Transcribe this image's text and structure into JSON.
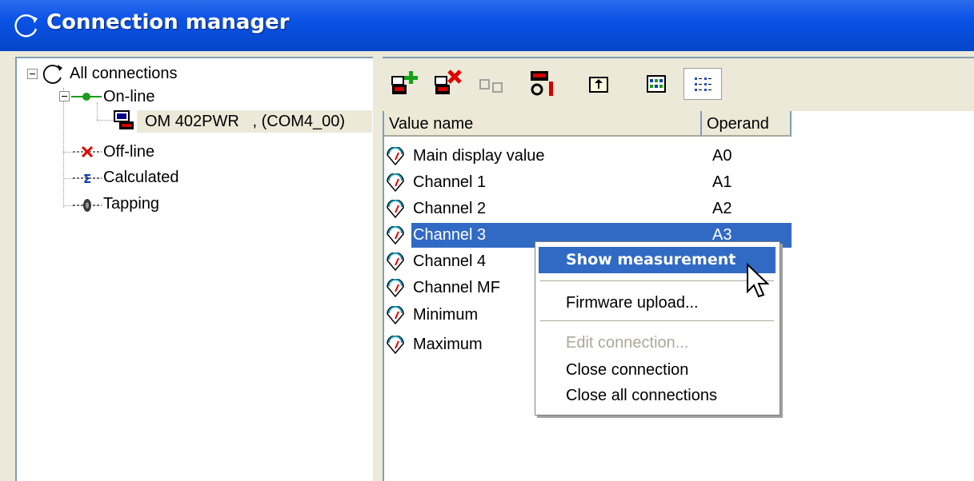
{
  "window": {
    "title": "Connection manager",
    "icon": "refresh-circle-icon"
  },
  "tree": {
    "root": {
      "label": "All connections",
      "icon": "refresh-circle-icon"
    },
    "online": {
      "label": "On-line",
      "icon": "online-link-icon"
    },
    "device": {
      "label": "OM 402PWR   , (COM4_00)",
      "icon": "device-icon"
    },
    "offline": {
      "label": "Off-line",
      "icon": "offline-link-icon"
    },
    "calculated": {
      "label": "Calculated",
      "icon": "sigma-link-icon"
    },
    "tapping": {
      "label": "Tapping",
      "icon": "ear-link-icon"
    }
  },
  "toolbar": {
    "buttons": [
      "add-connection-icon",
      "remove-connection-icon",
      "copy-icon",
      "device-settings-icon",
      "folder-up-icon",
      "large-icons-view-icon",
      "details-view-icon"
    ]
  },
  "list": {
    "columns": [
      "Value name",
      "Operand"
    ],
    "rows": [
      {
        "name": "Main display value",
        "operand": "A0"
      },
      {
        "name": "Channel 1",
        "operand": "A1"
      },
      {
        "name": "Channel 2",
        "operand": "A2"
      },
      {
        "name": "Channel 3",
        "operand": "A3"
      },
      {
        "name": "Channel 4",
        "operand": ""
      },
      {
        "name": "Channel MF",
        "operand": ""
      },
      {
        "name": "Minimum",
        "operand": ""
      },
      {
        "name": "Maximum",
        "operand": ""
      }
    ],
    "selected_index": 3
  },
  "context_menu": {
    "show_measurement": "Show measurement",
    "firmware_upload": "Firmware upload...",
    "edit_connection": "Edit connection...",
    "close_connection": "Close connection",
    "close_all": "Close all connections"
  },
  "colors": {
    "title_bar": "#0a52e6",
    "selection": "#316ac5",
    "face": "#ece9d8",
    "border": "#7f9db9"
  }
}
